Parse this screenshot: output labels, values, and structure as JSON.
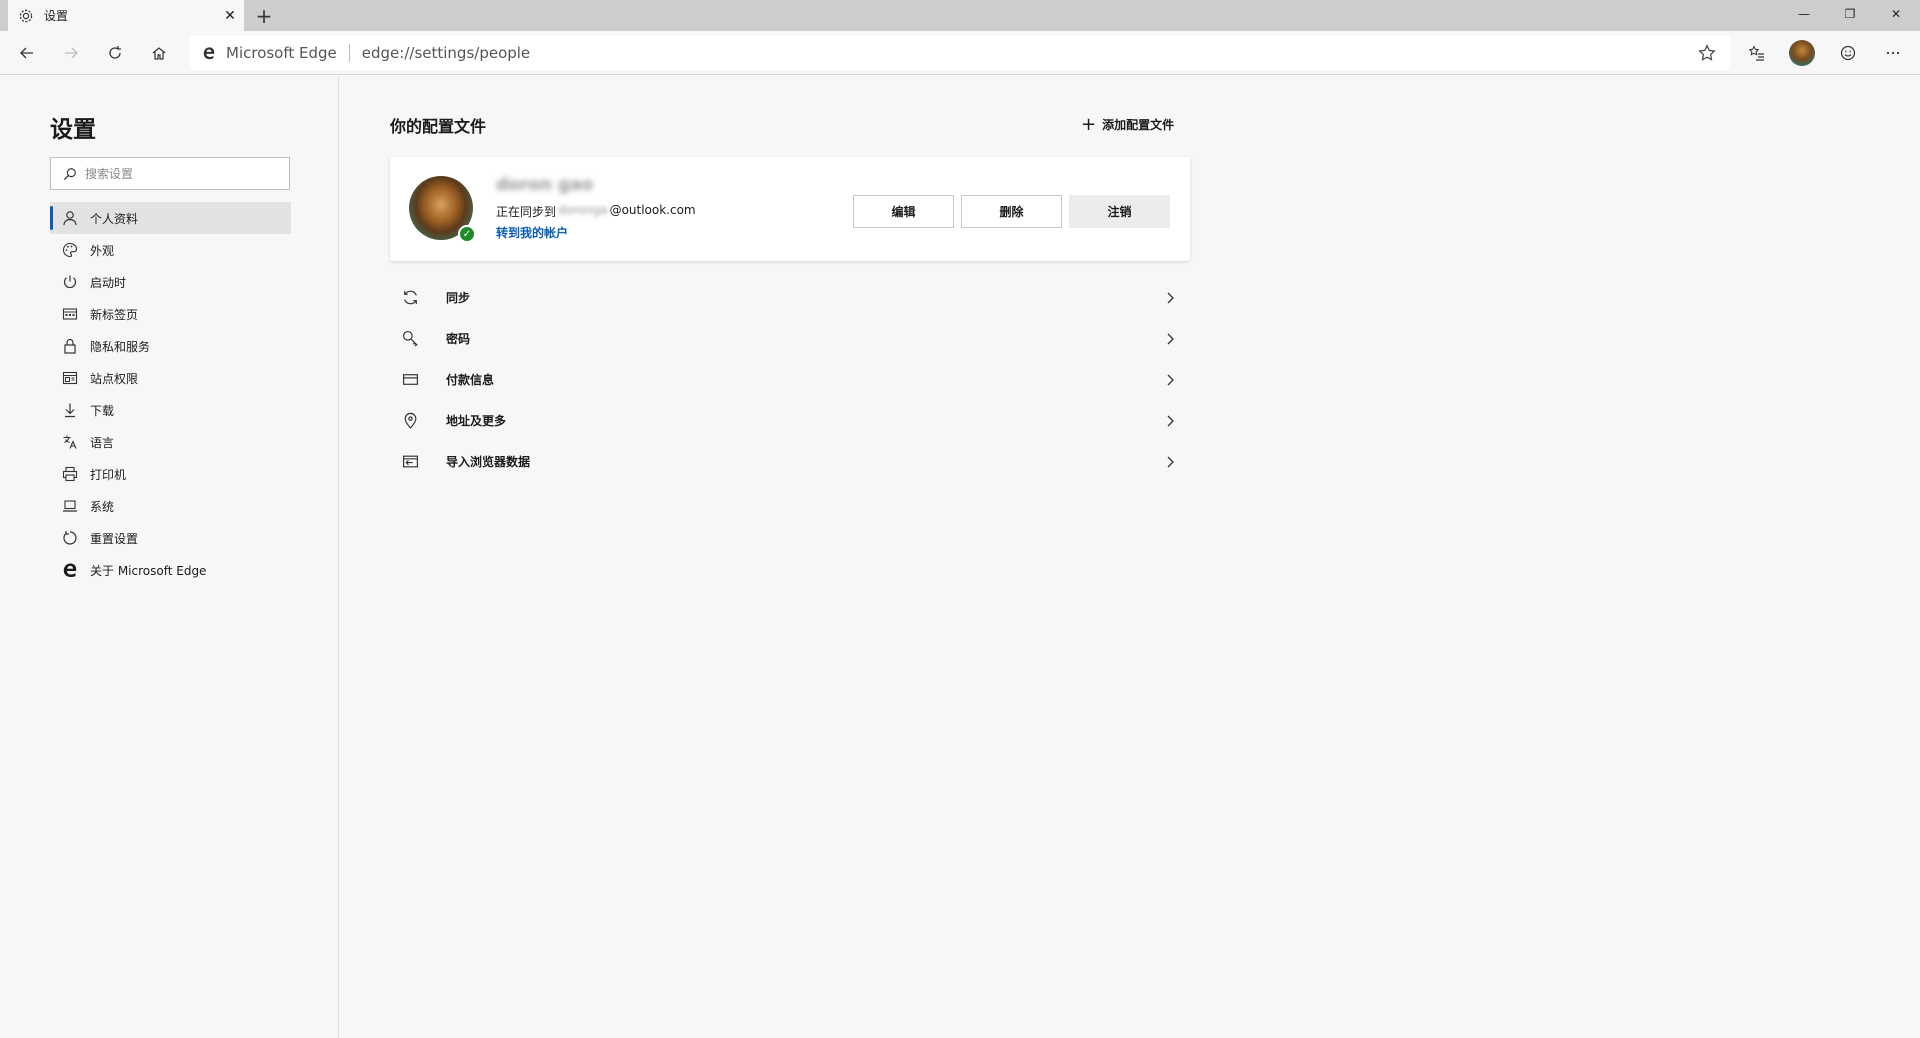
{
  "tab": {
    "title": "设置",
    "close": "✕",
    "new_tab": "+"
  },
  "window": {
    "minimize": "—",
    "restore": "❐",
    "close": "✕"
  },
  "address": {
    "site": "Microsoft Edge",
    "url": "edge://settings/people"
  },
  "sidebar": {
    "title": "设置",
    "search_placeholder": "搜索设置",
    "items": [
      {
        "label": "个人资料",
        "icon": "person-icon"
      },
      {
        "label": "外观",
        "icon": "palette-icon"
      },
      {
        "label": "启动时",
        "icon": "power-icon"
      },
      {
        "label": "新标签页",
        "icon": "new-tab-page-icon"
      },
      {
        "label": "隐私和服务",
        "icon": "lock-icon"
      },
      {
        "label": "站点权限",
        "icon": "site-permissions-icon"
      },
      {
        "label": "下载",
        "icon": "download-icon"
      },
      {
        "label": "语言",
        "icon": "language-icon"
      },
      {
        "label": "打印机",
        "icon": "printer-icon"
      },
      {
        "label": "系统",
        "icon": "laptop-icon"
      },
      {
        "label": "重置设置",
        "icon": "reset-icon"
      },
      {
        "label": "关于 Microsoft Edge",
        "icon": "edge-logo-icon"
      }
    ]
  },
  "main": {
    "title": "你的配置文件",
    "add_profile": "添加配置文件",
    "profile": {
      "name": "doron gao",
      "sync_prefix": "正在同步到",
      "sync_email_hidden": "doronga",
      "sync_email_domain": "@outlook.com",
      "manage_link": "转到我的帐户",
      "edit": "编辑",
      "delete": "删除",
      "sign_out": "注销"
    },
    "rows": [
      {
        "label": "同步",
        "icon": "sync-icon"
      },
      {
        "label": "密码",
        "icon": "key-icon"
      },
      {
        "label": "付款信息",
        "icon": "card-icon"
      },
      {
        "label": "地址及更多",
        "icon": "location-icon"
      },
      {
        "label": "导入浏览器数据",
        "icon": "import-icon"
      }
    ]
  }
}
